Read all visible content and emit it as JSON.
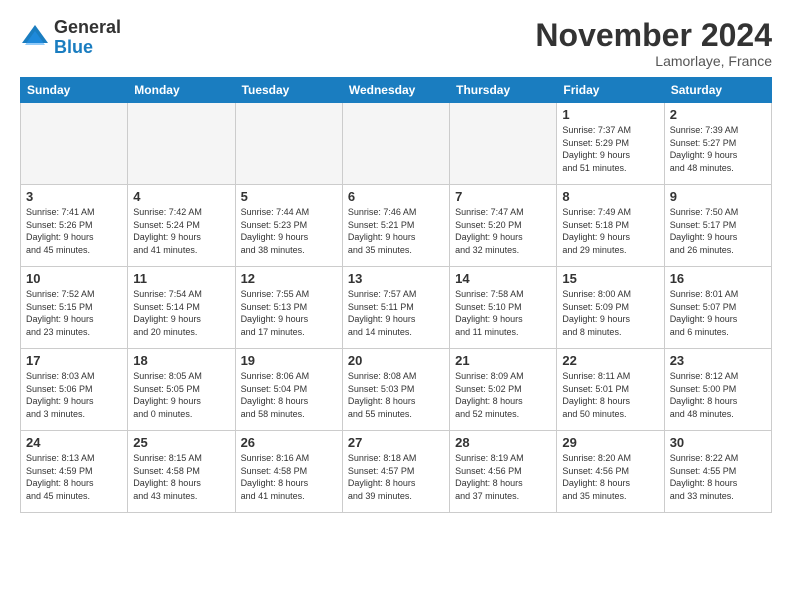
{
  "header": {
    "logo_general": "General",
    "logo_blue": "Blue",
    "month_title": "November 2024",
    "location": "Lamorlaye, France"
  },
  "weekdays": [
    "Sunday",
    "Monday",
    "Tuesday",
    "Wednesday",
    "Thursday",
    "Friday",
    "Saturday"
  ],
  "weeks": [
    [
      {
        "day": "",
        "empty": true
      },
      {
        "day": "",
        "empty": true
      },
      {
        "day": "",
        "empty": true
      },
      {
        "day": "",
        "empty": true
      },
      {
        "day": "",
        "empty": true
      },
      {
        "day": "1",
        "info": "Sunrise: 7:37 AM\nSunset: 5:29 PM\nDaylight: 9 hours\nand 51 minutes."
      },
      {
        "day": "2",
        "info": "Sunrise: 7:39 AM\nSunset: 5:27 PM\nDaylight: 9 hours\nand 48 minutes."
      }
    ],
    [
      {
        "day": "3",
        "info": "Sunrise: 7:41 AM\nSunset: 5:26 PM\nDaylight: 9 hours\nand 45 minutes."
      },
      {
        "day": "4",
        "info": "Sunrise: 7:42 AM\nSunset: 5:24 PM\nDaylight: 9 hours\nand 41 minutes."
      },
      {
        "day": "5",
        "info": "Sunrise: 7:44 AM\nSunset: 5:23 PM\nDaylight: 9 hours\nand 38 minutes."
      },
      {
        "day": "6",
        "info": "Sunrise: 7:46 AM\nSunset: 5:21 PM\nDaylight: 9 hours\nand 35 minutes."
      },
      {
        "day": "7",
        "info": "Sunrise: 7:47 AM\nSunset: 5:20 PM\nDaylight: 9 hours\nand 32 minutes."
      },
      {
        "day": "8",
        "info": "Sunrise: 7:49 AM\nSunset: 5:18 PM\nDaylight: 9 hours\nand 29 minutes."
      },
      {
        "day": "9",
        "info": "Sunrise: 7:50 AM\nSunset: 5:17 PM\nDaylight: 9 hours\nand 26 minutes."
      }
    ],
    [
      {
        "day": "10",
        "info": "Sunrise: 7:52 AM\nSunset: 5:15 PM\nDaylight: 9 hours\nand 23 minutes."
      },
      {
        "day": "11",
        "info": "Sunrise: 7:54 AM\nSunset: 5:14 PM\nDaylight: 9 hours\nand 20 minutes."
      },
      {
        "day": "12",
        "info": "Sunrise: 7:55 AM\nSunset: 5:13 PM\nDaylight: 9 hours\nand 17 minutes."
      },
      {
        "day": "13",
        "info": "Sunrise: 7:57 AM\nSunset: 5:11 PM\nDaylight: 9 hours\nand 14 minutes."
      },
      {
        "day": "14",
        "info": "Sunrise: 7:58 AM\nSunset: 5:10 PM\nDaylight: 9 hours\nand 11 minutes."
      },
      {
        "day": "15",
        "info": "Sunrise: 8:00 AM\nSunset: 5:09 PM\nDaylight: 9 hours\nand 8 minutes."
      },
      {
        "day": "16",
        "info": "Sunrise: 8:01 AM\nSunset: 5:07 PM\nDaylight: 9 hours\nand 6 minutes."
      }
    ],
    [
      {
        "day": "17",
        "info": "Sunrise: 8:03 AM\nSunset: 5:06 PM\nDaylight: 9 hours\nand 3 minutes."
      },
      {
        "day": "18",
        "info": "Sunrise: 8:05 AM\nSunset: 5:05 PM\nDaylight: 9 hours\nand 0 minutes."
      },
      {
        "day": "19",
        "info": "Sunrise: 8:06 AM\nSunset: 5:04 PM\nDaylight: 8 hours\nand 58 minutes."
      },
      {
        "day": "20",
        "info": "Sunrise: 8:08 AM\nSunset: 5:03 PM\nDaylight: 8 hours\nand 55 minutes."
      },
      {
        "day": "21",
        "info": "Sunrise: 8:09 AM\nSunset: 5:02 PM\nDaylight: 8 hours\nand 52 minutes."
      },
      {
        "day": "22",
        "info": "Sunrise: 8:11 AM\nSunset: 5:01 PM\nDaylight: 8 hours\nand 50 minutes."
      },
      {
        "day": "23",
        "info": "Sunrise: 8:12 AM\nSunset: 5:00 PM\nDaylight: 8 hours\nand 48 minutes."
      }
    ],
    [
      {
        "day": "24",
        "info": "Sunrise: 8:13 AM\nSunset: 4:59 PM\nDaylight: 8 hours\nand 45 minutes."
      },
      {
        "day": "25",
        "info": "Sunrise: 8:15 AM\nSunset: 4:58 PM\nDaylight: 8 hours\nand 43 minutes."
      },
      {
        "day": "26",
        "info": "Sunrise: 8:16 AM\nSunset: 4:58 PM\nDaylight: 8 hours\nand 41 minutes."
      },
      {
        "day": "27",
        "info": "Sunrise: 8:18 AM\nSunset: 4:57 PM\nDaylight: 8 hours\nand 39 minutes."
      },
      {
        "day": "28",
        "info": "Sunrise: 8:19 AM\nSunset: 4:56 PM\nDaylight: 8 hours\nand 37 minutes."
      },
      {
        "day": "29",
        "info": "Sunrise: 8:20 AM\nSunset: 4:56 PM\nDaylight: 8 hours\nand 35 minutes."
      },
      {
        "day": "30",
        "info": "Sunrise: 8:22 AM\nSunset: 4:55 PM\nDaylight: 8 hours\nand 33 minutes."
      }
    ]
  ]
}
